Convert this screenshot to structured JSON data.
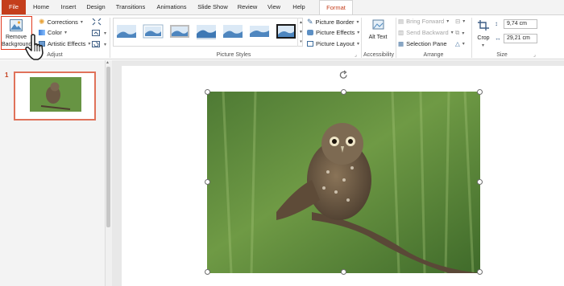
{
  "tabs": [
    "File",
    "Home",
    "Insert",
    "Design",
    "Transitions",
    "Animations",
    "Slide Show",
    "Review",
    "View",
    "Help",
    "Format"
  ],
  "ribbon": {
    "adjust": {
      "remove_background": "Remove Background",
      "corrections": "Corrections",
      "color": "Color",
      "artistic_effects": "Artistic Effects",
      "group_label": "Adjust"
    },
    "picture_styles": {
      "group_label": "Picture Styles",
      "picture_border": "Picture Border",
      "picture_effects": "Picture Effects",
      "picture_layout": "Picture Layout"
    },
    "accessibility": {
      "alt_text": "Alt Text",
      "group_label": "Accessibility"
    },
    "arrange": {
      "bring_forward": "Bring Forward",
      "send_backward": "Send Backward",
      "selection_pane": "Selection Pane",
      "group_label": "Arrange"
    },
    "size": {
      "crop": "Crop",
      "height": "9,74 cm",
      "width": "29,21 cm",
      "group_label": "Size"
    }
  },
  "slides": {
    "current_number": "1"
  },
  "colors": {
    "file_tab": "#c43e1c",
    "accent": "#c43e1c",
    "selection_outline": "#e03a1f"
  },
  "icons": [
    "remove-background-icon",
    "corrections-icon",
    "color-icon",
    "artistic-effects-icon",
    "compress-pictures-icon",
    "change-picture-icon",
    "reset-picture-icon",
    "picture-border-icon",
    "picture-effects-icon",
    "picture-layout-icon",
    "alt-text-icon",
    "bring-forward-icon",
    "send-backward-icon",
    "selection-pane-icon",
    "align-icon",
    "group-icon",
    "rotate-icon",
    "crop-icon",
    "height-icon",
    "width-icon",
    "rotation-handle-icon",
    "mouse-cursor-icon",
    "dialog-launcher-icon"
  ]
}
